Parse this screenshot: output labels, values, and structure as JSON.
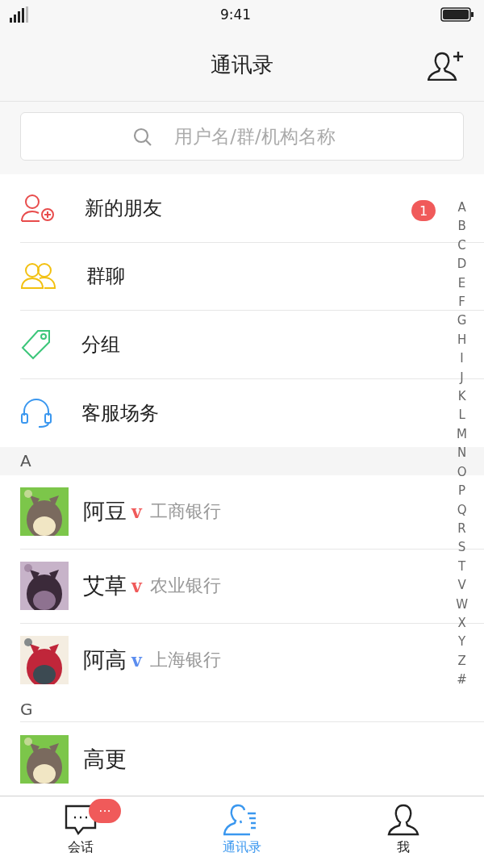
{
  "status_bar": {
    "time": "9:41"
  },
  "header": {
    "title": "通讯录"
  },
  "search": {
    "placeholder": "用户名/群/机构名称"
  },
  "menu": [
    {
      "kind": "new-friends",
      "label": "新的朋友",
      "badge": "1"
    },
    {
      "kind": "groups",
      "label": "群聊"
    },
    {
      "kind": "tags",
      "label": "分组"
    },
    {
      "kind": "service",
      "label": "客服场务"
    }
  ],
  "sections": [
    {
      "letter": "A",
      "contacts": [
        {
          "name": "阿豆",
          "mark": "v",
          "color": "#f05a5a",
          "bank": "工商银行"
        },
        {
          "name": "艾草",
          "mark": "v",
          "color": "#f05a5a",
          "bank": "农业银行"
        },
        {
          "name": "阿高",
          "mark": "v",
          "color": "#5b8def",
          "bank": "上海银行"
        }
      ]
    },
    {
      "letter": "G",
      "contacts": [
        {
          "name": "高更"
        }
      ]
    }
  ],
  "index": [
    "A",
    "B",
    "C",
    "D",
    "E",
    "F",
    "G",
    "H",
    "I",
    "J",
    "K",
    "L",
    "M",
    "N",
    "O",
    "P",
    "Q",
    "R",
    "S",
    "T",
    "V",
    "W",
    "X",
    "Y",
    "Z",
    "#"
  ],
  "tabs": [
    {
      "kind": "chat",
      "label": "会话",
      "selected": false,
      "badge": "···"
    },
    {
      "kind": "contacts",
      "label": "通讯录",
      "selected": true
    },
    {
      "kind": "me",
      "label": "我",
      "selected": false
    }
  ]
}
